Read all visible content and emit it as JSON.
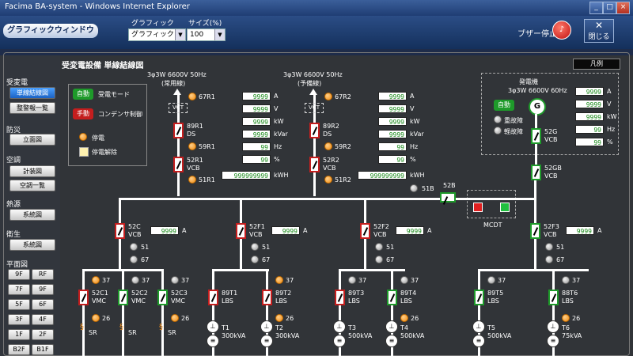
{
  "window": {
    "title": "Facima BA-system - Windows Internet Explorer",
    "buttons": {
      "minimize": "_",
      "maximize": "□",
      "close": "×"
    }
  },
  "toolbar": {
    "app_title": "グラフィックウィンドウ",
    "graphic_label": "グラフィック",
    "graphic_value": "グラフィック",
    "size_label": "サイズ(%)",
    "size_value": "100",
    "buzzer_label": "ブザー停止",
    "close_label": "閉じる"
  },
  "sidebar": {
    "groups": [
      {
        "heading": "受変電",
        "items": [
          "単線結線図",
          "整警報一覧"
        ]
      },
      {
        "heading": "防災",
        "items": [
          "立面図"
        ]
      },
      {
        "heading": "空調",
        "items": [
          "計装図",
          "空調一覧"
        ]
      },
      {
        "heading": "熱源",
        "items": [
          "系統図"
        ]
      },
      {
        "heading": "衛生",
        "items": [
          "系統図"
        ]
      },
      {
        "heading": "平面図",
        "items": []
      }
    ],
    "floors": [
      "9F",
      "RF",
      "7F",
      "9F",
      "5F",
      "6F",
      "3F",
      "4F",
      "1F",
      "2F",
      "B2F",
      "B1F"
    ]
  },
  "diagram": {
    "title": "受変電設備 単線結線図",
    "legend_button": "凡例",
    "mode_box": {
      "auto": "自動",
      "power_mode": "受電モード",
      "manual": "手動",
      "capacitor_control": "コンデンサ制御",
      "outage": "停電",
      "outage_release": "停電解除"
    },
    "incoming": [
      {
        "header1": "3φ3W 6600V 50Hz",
        "header2": "(常用線)",
        "vct": "VCT",
        "relay1": "67R1",
        "relay2": "59R1",
        "relay3": "51R1",
        "breaker1": "89R1",
        "breaker1_type": "DS",
        "breaker2": "52R1",
        "breaker2_type": "VCB",
        "readings": [
          {
            "v": "9999",
            "u": "A"
          },
          {
            "v": "9999",
            "u": "V"
          },
          {
            "v": "9999",
            "u": "kW"
          },
          {
            "v": "9999",
            "u": "kVar"
          },
          {
            "v": "99",
            "u": "Hz"
          },
          {
            "v": "99",
            "u": "%"
          },
          {
            "v": "999999999",
            "u": "kWH"
          }
        ]
      },
      {
        "header1": "3φ3W 6600V 50Hz",
        "header2": "(予備線)",
        "vct": "VCT",
        "relay1": "67R2",
        "relay2": "59R2",
        "relay3": "51R2",
        "breaker1": "89R2",
        "breaker1_type": "DS",
        "breaker2": "52R2",
        "breaker2_type": "VCB",
        "readings": [
          {
            "v": "9999",
            "u": "A"
          },
          {
            "v": "9999",
            "u": "V"
          },
          {
            "v": "9999",
            "u": "kW"
          },
          {
            "v": "9999",
            "u": "kVar"
          },
          {
            "v": "99",
            "u": "Hz"
          },
          {
            "v": "99",
            "u": "%"
          },
          {
            "v": "999999999",
            "u": "kWH"
          }
        ]
      }
    ],
    "generator": {
      "title": "発電機",
      "spec": "3φ3W 6600V 60Hz",
      "auto": "自動",
      "symbol": "G",
      "fault_heavy": "重故障",
      "fault_light": "軽故障",
      "breaker": "52G",
      "breaker_type": "VCB",
      "breaker2": "52GB",
      "breaker2_type": "VCB",
      "readings": [
        {
          "v": "9999",
          "u": "A"
        },
        {
          "v": "9999",
          "u": "V"
        },
        {
          "v": "9999",
          "u": "kW"
        },
        {
          "v": "99",
          "u": "Hz"
        },
        {
          "v": "99",
          "u": "%"
        }
      ]
    },
    "tie": {
      "relay": "51B",
      "breaker": "52B",
      "mcdt": "MCDT"
    },
    "feeders": [
      {
        "name": "52C",
        "type": "VCB",
        "value": "9999",
        "unit": "A",
        "r1": "51",
        "r2": "67"
      },
      {
        "name": "52F1",
        "type": "VCB",
        "value": "9999",
        "unit": "A",
        "r1": "51",
        "r2": "67"
      },
      {
        "name": "52F2",
        "type": "VCB",
        "value": "9999",
        "unit": "A",
        "r1": "51",
        "r2": "67"
      },
      {
        "name": "52F3",
        "type": "VCB",
        "value": "9999",
        "unit": "A",
        "r1": "51",
        "r2": "67"
      }
    ],
    "loads": [
      {
        "relay": "37",
        "name": "52C1",
        "type": "VMC",
        "r2": "26",
        "end": "SR"
      },
      {
        "relay": "37",
        "name": "52C2",
        "type": "VMC",
        "r2": "",
        "end": "SR"
      },
      {
        "relay": "37",
        "name": "52C3",
        "type": "VMC",
        "r2": "26",
        "end": "SR"
      },
      {
        "relay": "",
        "name": "89T1",
        "type": "LBS",
        "r2": "",
        "end": "T1",
        "kva": "300kVA"
      },
      {
        "relay": "37",
        "name": "89T2",
        "type": "LBS",
        "r2": "26",
        "end": "T2",
        "kva": "300kVA"
      },
      {
        "relay": "37",
        "name": "89T3",
        "type": "LBS",
        "r2": "",
        "end": "T3",
        "kva": "500kVA"
      },
      {
        "relay": "37",
        "name": "89T4",
        "type": "LBS",
        "r2": "26",
        "end": "T4",
        "kva": "500kVA"
      },
      {
        "relay": "37",
        "name": "89T5",
        "type": "LBS",
        "r2": "",
        "end": "T5",
        "kva": "500kVA"
      },
      {
        "relay": "37",
        "name": "88T6",
        "type": "LBS",
        "r2": "26",
        "end": "T6",
        "kva": "75kVA"
      }
    ]
  }
}
